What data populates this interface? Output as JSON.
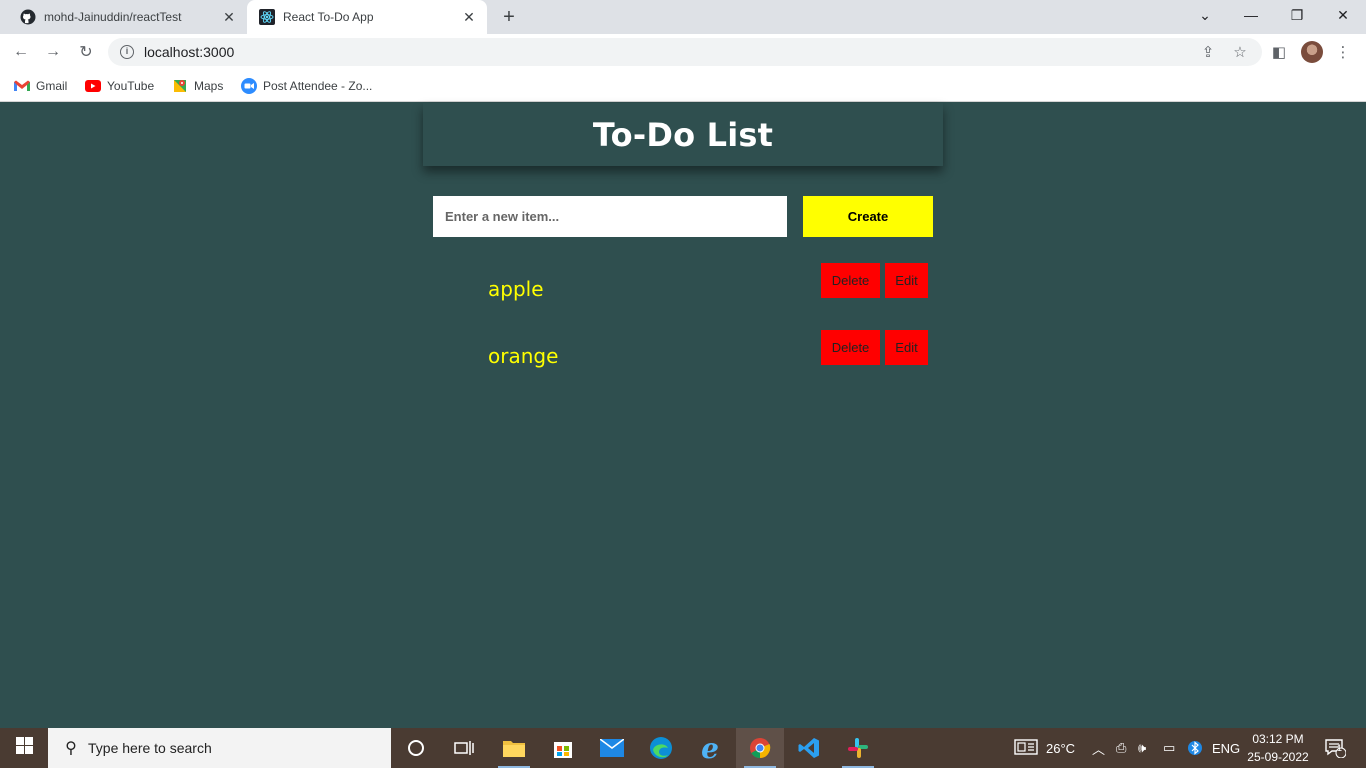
{
  "browser": {
    "tabs": [
      {
        "title": "mohd-Jainuddin/reactTest",
        "icon": "github-icon"
      },
      {
        "title": "React To-Do App",
        "icon": "react-icon"
      }
    ],
    "url": "localhost:3000",
    "bookmarks": [
      {
        "label": "Gmail",
        "icon": "gmail-icon"
      },
      {
        "label": "YouTube",
        "icon": "youtube-icon"
      },
      {
        "label": "Maps",
        "icon": "maps-icon"
      },
      {
        "label": "Post Attendee - Zo...",
        "icon": "zoom-icon"
      }
    ]
  },
  "app": {
    "heading": "To-Do List",
    "input_placeholder": "Enter a new item...",
    "input_value": "",
    "create_label": "Create",
    "items": [
      {
        "text": "apple",
        "delete_label": "Delete",
        "edit_label": "Edit"
      },
      {
        "text": "orange",
        "delete_label": "Delete",
        "edit_label": "Edit"
      }
    ]
  },
  "taskbar": {
    "search_placeholder": "Type here to search",
    "weather": "26°C",
    "language": "ENG",
    "time": "03:12 PM",
    "date": "25-09-2022",
    "notification_count": "1"
  },
  "colors": {
    "page_bg": "#2f4f4f",
    "accent_yellow": "#ffff00",
    "action_red": "#ff0000"
  }
}
